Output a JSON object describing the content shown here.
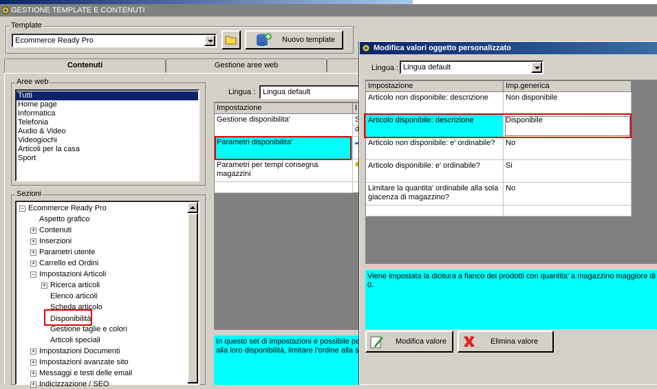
{
  "app": {
    "title": "GESTIONE TEMPLATE E CONTENUTI"
  },
  "template": {
    "group_label": "Template",
    "selected": "Ecommerce Ready Pro",
    "new_button": "Nuovo template"
  },
  "tabs": [
    "Contenuti",
    "Gestione aree web"
  ],
  "aree_web": {
    "label": "Aree web",
    "items": [
      "Tutti",
      "Home page",
      "Informatica",
      "Telefonia",
      "Audio & Video",
      "Videogiochi",
      "Articoli per la casa",
      "Sport"
    ]
  },
  "sezioni": {
    "label": "Sezioni",
    "tree": [
      {
        "label": "Ecommerce Ready Pro",
        "expander": "minus"
      },
      {
        "label": "Aspetto grafico",
        "expander": ""
      },
      {
        "label": "Contenuti",
        "expander": "plus"
      },
      {
        "label": "Inserzioni",
        "expander": "plus"
      },
      {
        "label": "Parametri utente",
        "expander": "plus"
      },
      {
        "label": "Carrello ed Ordini",
        "expander": "plus"
      },
      {
        "label": "Impostazioni Articoli",
        "expander": "minus"
      },
      {
        "label": "Ricerca articoli",
        "expander": "plus"
      },
      {
        "label": "Elenco articoli",
        "expander": ""
      },
      {
        "label": "Scheda articolo",
        "expander": ""
      },
      {
        "label": "Disponibilità",
        "expander": ""
      },
      {
        "label": "Gestione taglie e colori",
        "expander": ""
      },
      {
        "label": "Articoli speciali",
        "expander": ""
      },
      {
        "label": "Impostazioni Documenti",
        "expander": "plus"
      },
      {
        "label": "Impostazioni avanzate sito",
        "expander": "plus"
      },
      {
        "label": "Messaggi e testi delle email",
        "expander": "plus"
      },
      {
        "label": "Indicizzazione / SEO",
        "expander": "plus"
      }
    ]
  },
  "main": {
    "lingua_label": "Lingua :",
    "lingua_value": "Lingua default",
    "grid_header": [
      "Impostazione",
      "I"
    ],
    "rows": [
      {
        "name": "Gestione disponibilita'",
        "val1": "S",
        "val2": "d"
      },
      {
        "name": "Parametri disponibilita'",
        "val1": "",
        "val2": ""
      },
      {
        "name": "Parametri per tempi consegna magazzini",
        "val1": "",
        "val2": ""
      }
    ],
    "description": "In questo set di impostazioni è possibile per",
    "description2": "alla loro disponibilità, limitare l'ordine alla sol"
  },
  "dialog": {
    "title": "Modifica valori oggetto personalizzato",
    "lingua_label": "Lingua :",
    "lingua_value": "Lingua default",
    "header": [
      "Impostazione",
      "Imp.generica"
    ],
    "rows": [
      {
        "name": "Articolo non disponibile: descrizione",
        "value": "Non disponibile"
      },
      {
        "name": "Articolo disponibile: descrizione",
        "value": "Disponibile"
      },
      {
        "name": "Articolo non disponibile: e' ordinabile?",
        "value": "No"
      },
      {
        "name": "Articolo disponibile: e' ordinabile?",
        "value": "Si"
      },
      {
        "name": "Limitare la quantita' ordinabile alla sola giacenza di magazzino?",
        "value": "No"
      }
    ],
    "description": "Viene impostata la dicitura a fianco dei prodotti con quantita' a magazzino maggiore di 0.",
    "modify_button": "Modifica valore",
    "delete_button": "Elimina valore"
  },
  "colors": {
    "highlight": "#00ffff",
    "selection": "#0a246a",
    "marker": "#e00000"
  }
}
